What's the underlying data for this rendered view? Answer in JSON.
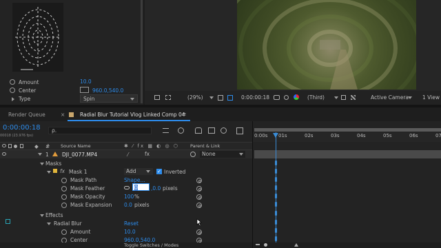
{
  "effect_controls": {
    "amount_label": "Amount",
    "amount_value": "10.0",
    "center_label": "Center",
    "center_value": "960.0,540.0",
    "type_label": "Type",
    "type_value": "Spin"
  },
  "viewer": {
    "zoom": "(29%)",
    "timecode": "0:00:00:18",
    "resolution": "(Third)",
    "camera": "Active Camera",
    "views": "1 View"
  },
  "tabs": {
    "render_queue": "Render Queue",
    "comp": "Radial Blur Tutorial Vlog Linked Comp 04"
  },
  "timeline": {
    "current_time": "0:00:00:18",
    "frame_info": "00018 (23.976 fps)",
    "search_placeholder": "ρ.",
    "source_name_header": "Source Name",
    "parent_header": "Parent & Link",
    "hash_header": "#",
    "ruler": [
      "0:00s",
      "01s",
      "02s",
      "03s",
      "04s",
      "05s",
      "06s",
      "07"
    ],
    "layer": {
      "index": "1",
      "name": "DJI_0077.MP4",
      "parent": "None"
    },
    "masks_label": "Masks",
    "mask1": {
      "name": "Mask 1",
      "mode": "Add",
      "inverted": "Inverted",
      "path_label": "Mask Path",
      "path_value": "Shape...",
      "feather_label": "Mask Feather",
      "feather_value_x": "0",
      "feather_value_y": ",0.0",
      "feather_unit": "pixels",
      "opacity_label": "Mask Opacity",
      "opacity_value": "100",
      "opacity_unit": "%",
      "expansion_label": "Mask Expansion",
      "expansion_value": "0.0",
      "expansion_unit": "pixels"
    },
    "effects_label": "Effects",
    "radial_blur": {
      "name": "Radial Blur",
      "reset": "Reset",
      "amount_label": "Amount",
      "amount_value": "10.0",
      "center_label": "Center",
      "center_value": "960.0,540.0"
    },
    "footer": "Toggle Switches / Modes"
  },
  "colors": {
    "accent": "#2d8ceb",
    "panel": "#232323",
    "dark": "#1b1b1b",
    "label_yellow": "#e0b53b",
    "label_teal": "#2aa6b8"
  }
}
